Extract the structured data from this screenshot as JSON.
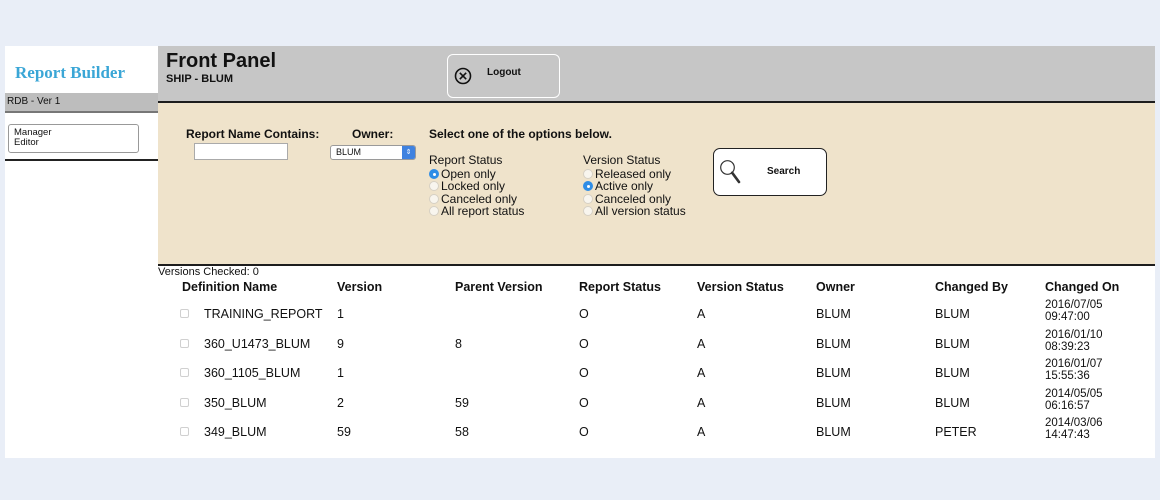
{
  "sidebar": {
    "brand": "Report Builder",
    "version": "RDB - Ver 1",
    "menu": [
      "Manager",
      "Editor"
    ]
  },
  "header": {
    "title": "Front Panel",
    "subtitle": "SHIP - BLUM",
    "logout_label": "Logout"
  },
  "filters": {
    "name_label": "Report Name Contains:",
    "name_value": "",
    "owner_label": "Owner:",
    "owner_value": "BLUM",
    "instruction": "Select one of the options below.",
    "report_status": {
      "title": "Report Status",
      "options": [
        {
          "label": "Open only",
          "selected": true
        },
        {
          "label": "Locked only",
          "selected": false
        },
        {
          "label": "Canceled only",
          "selected": false
        },
        {
          "label": "All report status",
          "selected": false
        }
      ]
    },
    "version_status": {
      "title": "Version Status",
      "options": [
        {
          "label": "Released only",
          "selected": false
        },
        {
          "label": "Active only",
          "selected": true
        },
        {
          "label": "Canceled only",
          "selected": false
        },
        {
          "label": "All version status",
          "selected": false
        }
      ]
    },
    "search_label": "Search"
  },
  "table": {
    "checked_text": "Versions Checked: 0",
    "columns": [
      "Definition Name",
      "Version",
      "Parent Version",
      "Report Status",
      "Version Status",
      "Owner",
      "Changed By",
      "Changed On"
    ],
    "rows": [
      {
        "name": "TRAINING_REPORT",
        "version": "1",
        "parent": "",
        "report_status": "O",
        "version_status": "A",
        "owner": "BLUM",
        "changed_by": "BLUM",
        "date": "2016/07/05",
        "time": "09:47:00"
      },
      {
        "name": "360_U1473_BLUM",
        "version": "9",
        "parent": "8",
        "report_status": "O",
        "version_status": "A",
        "owner": "BLUM",
        "changed_by": "BLUM",
        "date": "2016/01/10",
        "time": "08:39:23"
      },
      {
        "name": "360_1105_BLUM",
        "version": "1",
        "parent": "",
        "report_status": "O",
        "version_status": "A",
        "owner": "BLUM",
        "changed_by": "BLUM",
        "date": "2016/01/07",
        "time": "15:55:36"
      },
      {
        "name": "350_BLUM",
        "version": "2",
        "parent": "59",
        "report_status": "O",
        "version_status": "A",
        "owner": "BLUM",
        "changed_by": "BLUM",
        "date": "2014/05/05",
        "time": "06:16:57"
      },
      {
        "name": "349_BLUM",
        "version": "59",
        "parent": "58",
        "report_status": "O",
        "version_status": "A",
        "owner": "BLUM",
        "changed_by": "PETER",
        "date": "2014/03/06",
        "time": "14:47:43"
      }
    ]
  }
}
